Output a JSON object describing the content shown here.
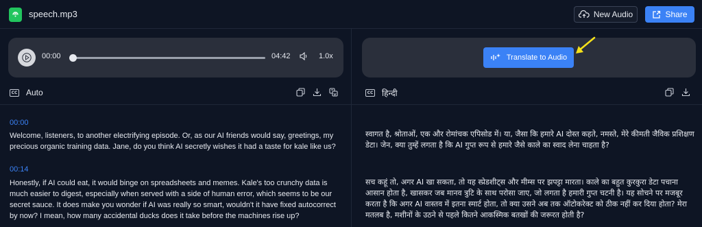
{
  "header": {
    "file_name": "speech.mp3",
    "new_audio_label": "New Audio",
    "share_label": "Share"
  },
  "player": {
    "current_time": "00:00",
    "duration": "04:42",
    "speed": "1.0x",
    "progress": 0.0
  },
  "translate": {
    "button_label": "Translate to Audio"
  },
  "source": {
    "language": "Auto",
    "segments": [
      {
        "timestamp": "00:00",
        "text": "Welcome, listeners, to another electrifying episode. Or, as our AI friends would say, greetings, my precious organic training data. Jane, do you think AI secretly wishes it had a taste for kale like us?"
      },
      {
        "timestamp": "00:14",
        "text": "Honestly, if AI could eat, it would binge on spreadsheets and memes. Kale's too crunchy data is much easier to digest, especially when served with a side of human error, which seems to be our secret sauce. It does make you wonder if AI was really so smart, wouldn't it have fixed autocorrect by now? I mean, how many accidental ducks does it take before the machines rise up?"
      }
    ]
  },
  "target": {
    "language": "हिन्दी",
    "segments": [
      "स्वागत है, श्रोताओं, एक और रोमांचक एपिसोड में। या, जैसा कि हमारे AI दोस्त कहते, नमस्ते, मेरे कीमती जैविक प्रशिक्षण डेटा। जेन, क्या तुम्हें लगता है कि AI गुप्त रूप से हमारे जैसे काले का स्वाद लेना चाहता है?",
      "सच कहूं तो, अगर AI खा सकता, तो यह स्प्रेडशीट्स और मीम्स पर झपट्टा मारता। काले का बहुत कुरकुरा डेटा पचाना आसान होता है, खासकर जब मानव त्रुटि के साथ परोसा जाए, जो लगता है हमारी गुप्त चटनी है। यह सोचने पर मजबूर करता है कि अगर AI वास्तव में इतना स्मार्ट होता, तो क्या उसने अब तक ऑटोकरेक्ट को ठीक नहीं कर दिया होता? मेरा मतलब है, मशीनों के उठने से पहले कितने आकस्मिक बतखों की जरूरत होती है?"
    ]
  },
  "colors": {
    "accent": "#3b82f6",
    "file_icon": "#22c55e",
    "arrow": "#f5e11a",
    "background": "#0e1524",
    "panel": "#2a2f3b"
  },
  "icons": {
    "file": "audio-file-icon",
    "new_audio": "cloud-upload-icon",
    "share": "share-icon",
    "play": "play-icon",
    "volume": "volume-icon",
    "translate": "sparkle-waveform-icon",
    "cc": "captions-icon",
    "copy": "copy-icon",
    "download": "download-icon",
    "translate_tool": "translate-icon"
  }
}
